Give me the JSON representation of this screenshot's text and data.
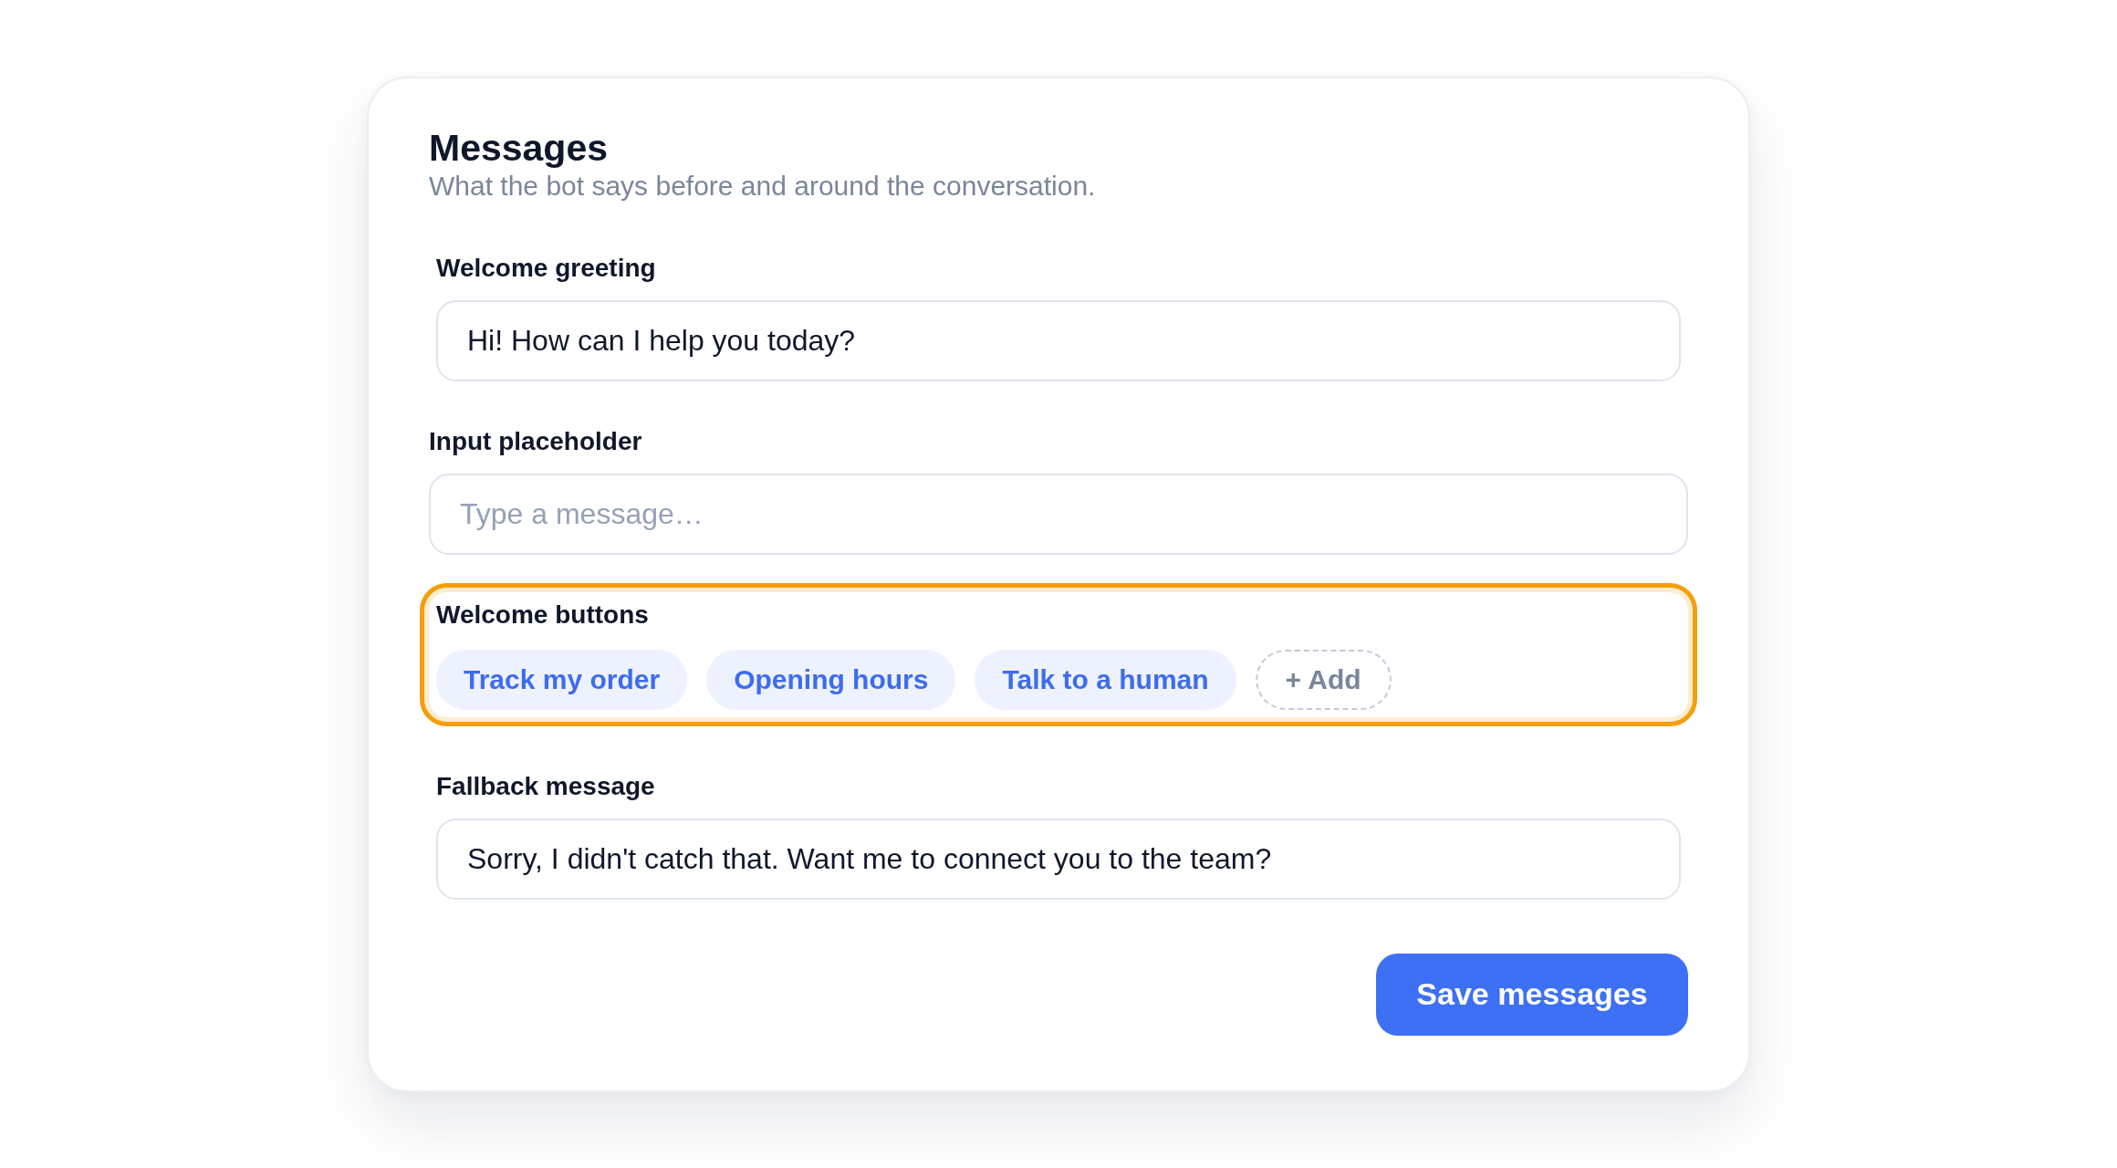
{
  "header": {
    "title": "Messages",
    "subtitle": "What the bot says before and around the conversation."
  },
  "fields": [
    {
      "kind": "text",
      "label": "Welcome greeting",
      "value": "Hi! How can I help you today?",
      "highlighted": false
    },
    {
      "kind": "placeholder",
      "label": "Input placeholder",
      "placeholder": "Type a message…",
      "highlighted": false
    },
    {
      "kind": "chips",
      "label": "Welcome buttons",
      "chips": [
        "Track my order",
        "Opening hours",
        "Talk to a human"
      ],
      "add_label": "+ Add",
      "highlighted": true
    },
    {
      "kind": "text",
      "label": "Fallback message",
      "value": "Sorry, I didn't catch that. Want me to connect you to the team?",
      "highlighted": false
    }
  ],
  "save_button": "Save messages"
}
